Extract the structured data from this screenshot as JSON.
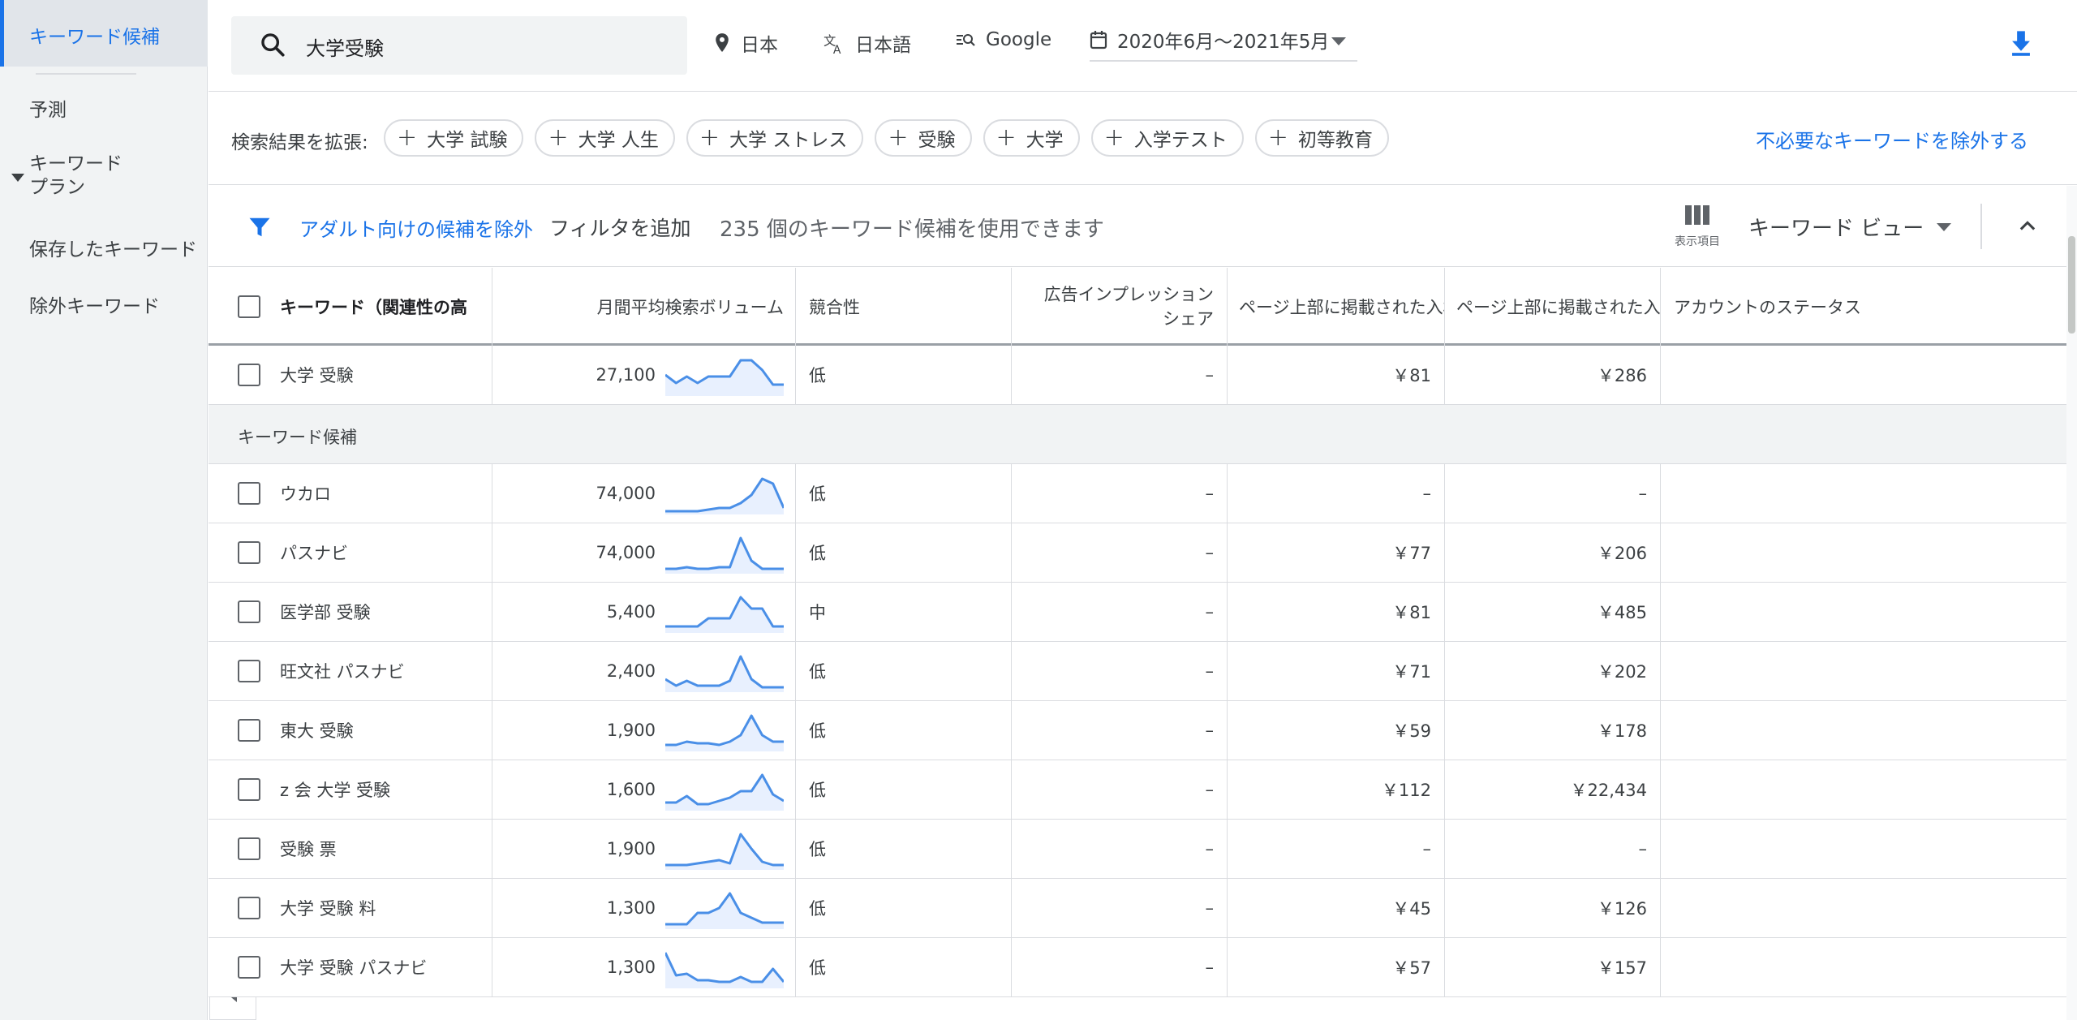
{
  "sidebar": {
    "items": [
      {
        "label": "キーワード候補"
      },
      {
        "label": "予測"
      },
      {
        "label": "キーワード\nプラン"
      },
      {
        "label": "保存したキーワード"
      },
      {
        "label": "除外キーワード"
      }
    ]
  },
  "topbar": {
    "search_value": "大学受験",
    "location": "日本",
    "language": "日本語",
    "network": "Google",
    "date_range": "2020年6月〜2021年5月"
  },
  "expand": {
    "label": "検索結果を拡張:",
    "chips": [
      "大学 試験",
      "大学 人生",
      "大学 ストレス",
      "受験",
      "大学",
      "入学テスト",
      "初等教育"
    ],
    "exclude_link": "不必要なキーワードを除外する"
  },
  "filter": {
    "adult_filter": "アダルト向けの候補を除外",
    "add_filter": "フィルタを追加",
    "count_text": "235 個のキーワード候補を使用できます",
    "columns_label": "表示項目",
    "view_label": "キーワード ビュー"
  },
  "table": {
    "headers": [
      "キーワード（関連性の高",
      "月間平均検索ボリューム",
      "競合性",
      "広告インプレッション\nシェア",
      "ページ上部に掲載された入札単価（低額帯）",
      "ページ上部に掲載された入札単価（高額帯）",
      "アカウントのステータス"
    ],
    "searched_row": {
      "keyword": "大学 受験",
      "volume": "27,100",
      "competition": "低",
      "impression_share": "–",
      "bid_low": "￥81",
      "bid_high": "￥286",
      "trend": [
        0.55,
        0.3,
        0.5,
        0.3,
        0.5,
        0.5,
        0.5,
        1.0,
        1.0,
        0.7,
        0.25,
        0.25
      ]
    },
    "section_label": "キーワード候補",
    "rows": [
      {
        "keyword": "ウカロ",
        "volume": "74,000",
        "competition": "低",
        "impression_share": "–",
        "bid_low": "–",
        "bid_high": "–",
        "trend": [
          0.0,
          0.0,
          0.0,
          0.0,
          0.05,
          0.1,
          0.1,
          0.25,
          0.5,
          1.0,
          0.85,
          0.1
        ]
      },
      {
        "keyword": "パスナビ",
        "volume": "74,000",
        "competition": "低",
        "impression_share": "–",
        "bid_low": "￥77",
        "bid_high": "￥206",
        "trend": [
          0.05,
          0.05,
          0.1,
          0.05,
          0.05,
          0.1,
          0.1,
          1.0,
          0.3,
          0.05,
          0.05,
          0.05
        ]
      },
      {
        "keyword": "医学部 受験",
        "volume": "5,400",
        "competition": "中",
        "impression_share": "–",
        "bid_low": "￥81",
        "bid_high": "￥485",
        "trend": [
          0.1,
          0.1,
          0.1,
          0.1,
          0.35,
          0.35,
          0.35,
          1.0,
          0.65,
          0.65,
          0.1,
          0.1
        ]
      },
      {
        "keyword": "旺文社 パスナビ",
        "volume": "2,400",
        "competition": "低",
        "impression_share": "–",
        "bid_low": "￥71",
        "bid_high": "￥202",
        "trend": [
          0.3,
          0.1,
          0.25,
          0.1,
          0.1,
          0.1,
          0.25,
          1.0,
          0.3,
          0.05,
          0.05,
          0.05
        ]
      },
      {
        "keyword": "東大 受験",
        "volume": "1,900",
        "competition": "低",
        "impression_share": "–",
        "bid_low": "￥59",
        "bid_high": "￥178",
        "trend": [
          0.1,
          0.1,
          0.2,
          0.15,
          0.15,
          0.1,
          0.2,
          0.4,
          1.0,
          0.4,
          0.2,
          0.2
        ]
      },
      {
        "keyword": "z 会 大学 受験",
        "volume": "1,600",
        "competition": "低",
        "impression_share": "–",
        "bid_low": "￥112",
        "bid_high": "￥22,434",
        "trend": [
          0.15,
          0.15,
          0.35,
          0.1,
          0.1,
          0.2,
          0.3,
          0.5,
          0.5,
          1.0,
          0.4,
          0.2
        ]
      },
      {
        "keyword": "受験 票",
        "volume": "1,900",
        "competition": "低",
        "impression_share": "–",
        "bid_low": "–",
        "bid_high": "–",
        "trend": [
          0.05,
          0.05,
          0.05,
          0.1,
          0.15,
          0.2,
          0.1,
          1.0,
          0.55,
          0.15,
          0.05,
          0.05
        ]
      },
      {
        "keyword": "大学 受験 料",
        "volume": "1,300",
        "competition": "低",
        "impression_share": "–",
        "bid_low": "￥45",
        "bid_high": "￥126",
        "trend": [
          0.05,
          0.05,
          0.05,
          0.4,
          0.4,
          0.55,
          1.0,
          0.4,
          0.25,
          0.1,
          0.1,
          0.1
        ]
      },
      {
        "keyword": "大学 受験 パスナビ",
        "volume": "1,300",
        "competition": "低",
        "impression_share": "–",
        "bid_low": "￥57",
        "bid_high": "￥157",
        "trend": [
          1.0,
          0.3,
          0.35,
          0.15,
          0.15,
          0.1,
          0.1,
          0.25,
          0.1,
          0.1,
          0.5,
          0.1
        ]
      }
    ]
  },
  "colors": {
    "accent": "#1a73e8",
    "sidebar_bg": "#f1f3f4",
    "sparkline": "#4a8fe7",
    "sparkfill": "#e8f0fe"
  }
}
